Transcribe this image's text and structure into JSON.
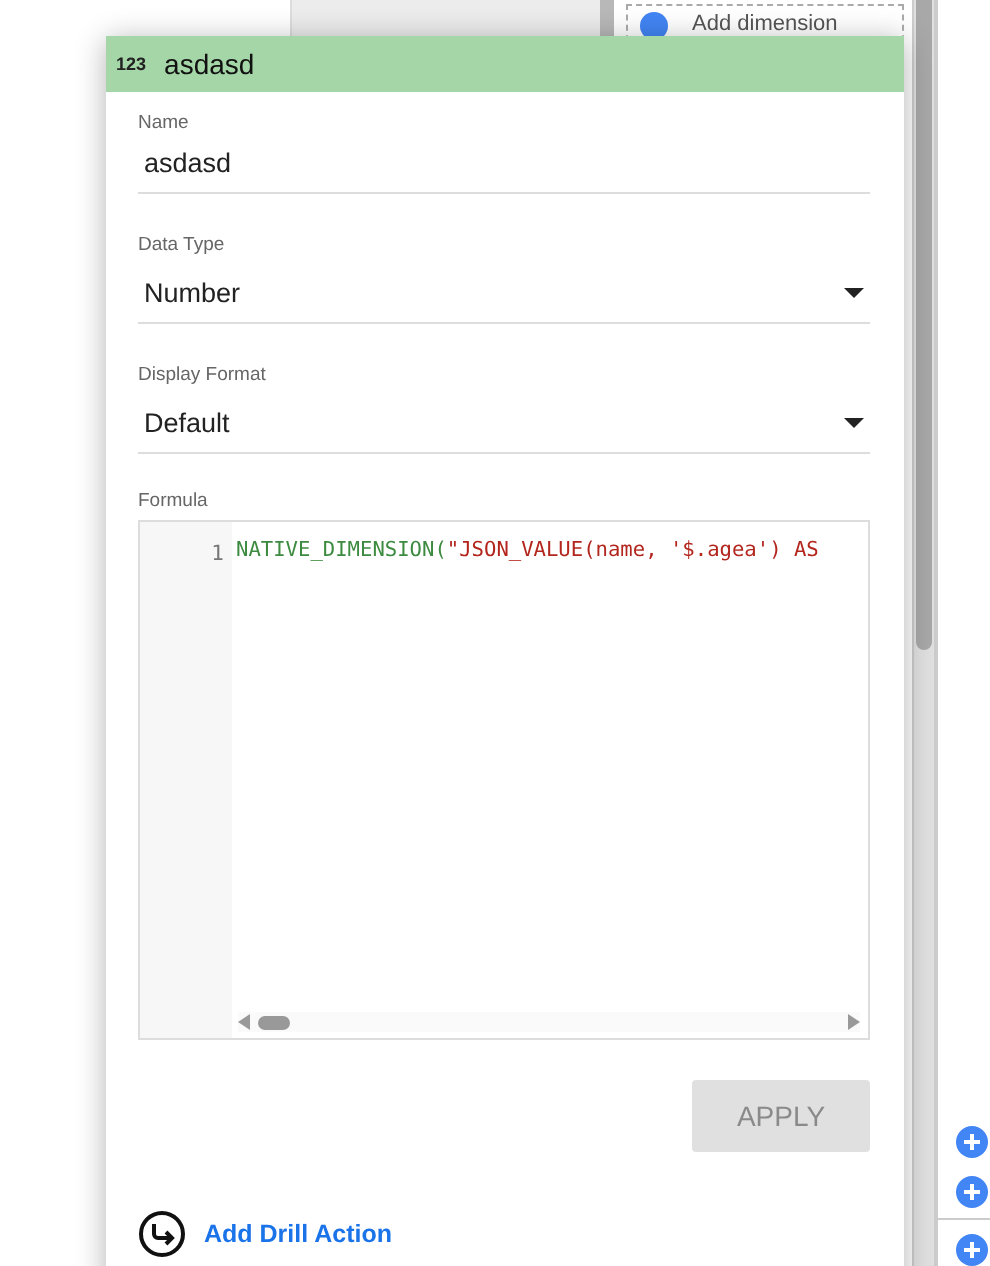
{
  "background": {
    "add_dimension": "Add dimension"
  },
  "dialog": {
    "type_icon": "123",
    "title": "asdasd",
    "fields": [
      {
        "kind": "text",
        "label": "Name",
        "value": "asdasd"
      },
      {
        "kind": "select",
        "label": "Data Type",
        "value": "Number"
      },
      {
        "kind": "select",
        "label": "Display Format",
        "value": "Default"
      }
    ],
    "formula": {
      "label": "Formula",
      "lines": [
        {
          "number": "1",
          "tokens": [
            {
              "kind": "function",
              "text": "NATIVE_DIMENSION("
            },
            {
              "kind": "string",
              "text": "\"JSON_VALUE(name, '$.agea') AS"
            }
          ]
        }
      ]
    },
    "apply_button": {
      "label": "APPLY",
      "disabled": true
    },
    "drill_action": "Add Drill Action"
  }
}
